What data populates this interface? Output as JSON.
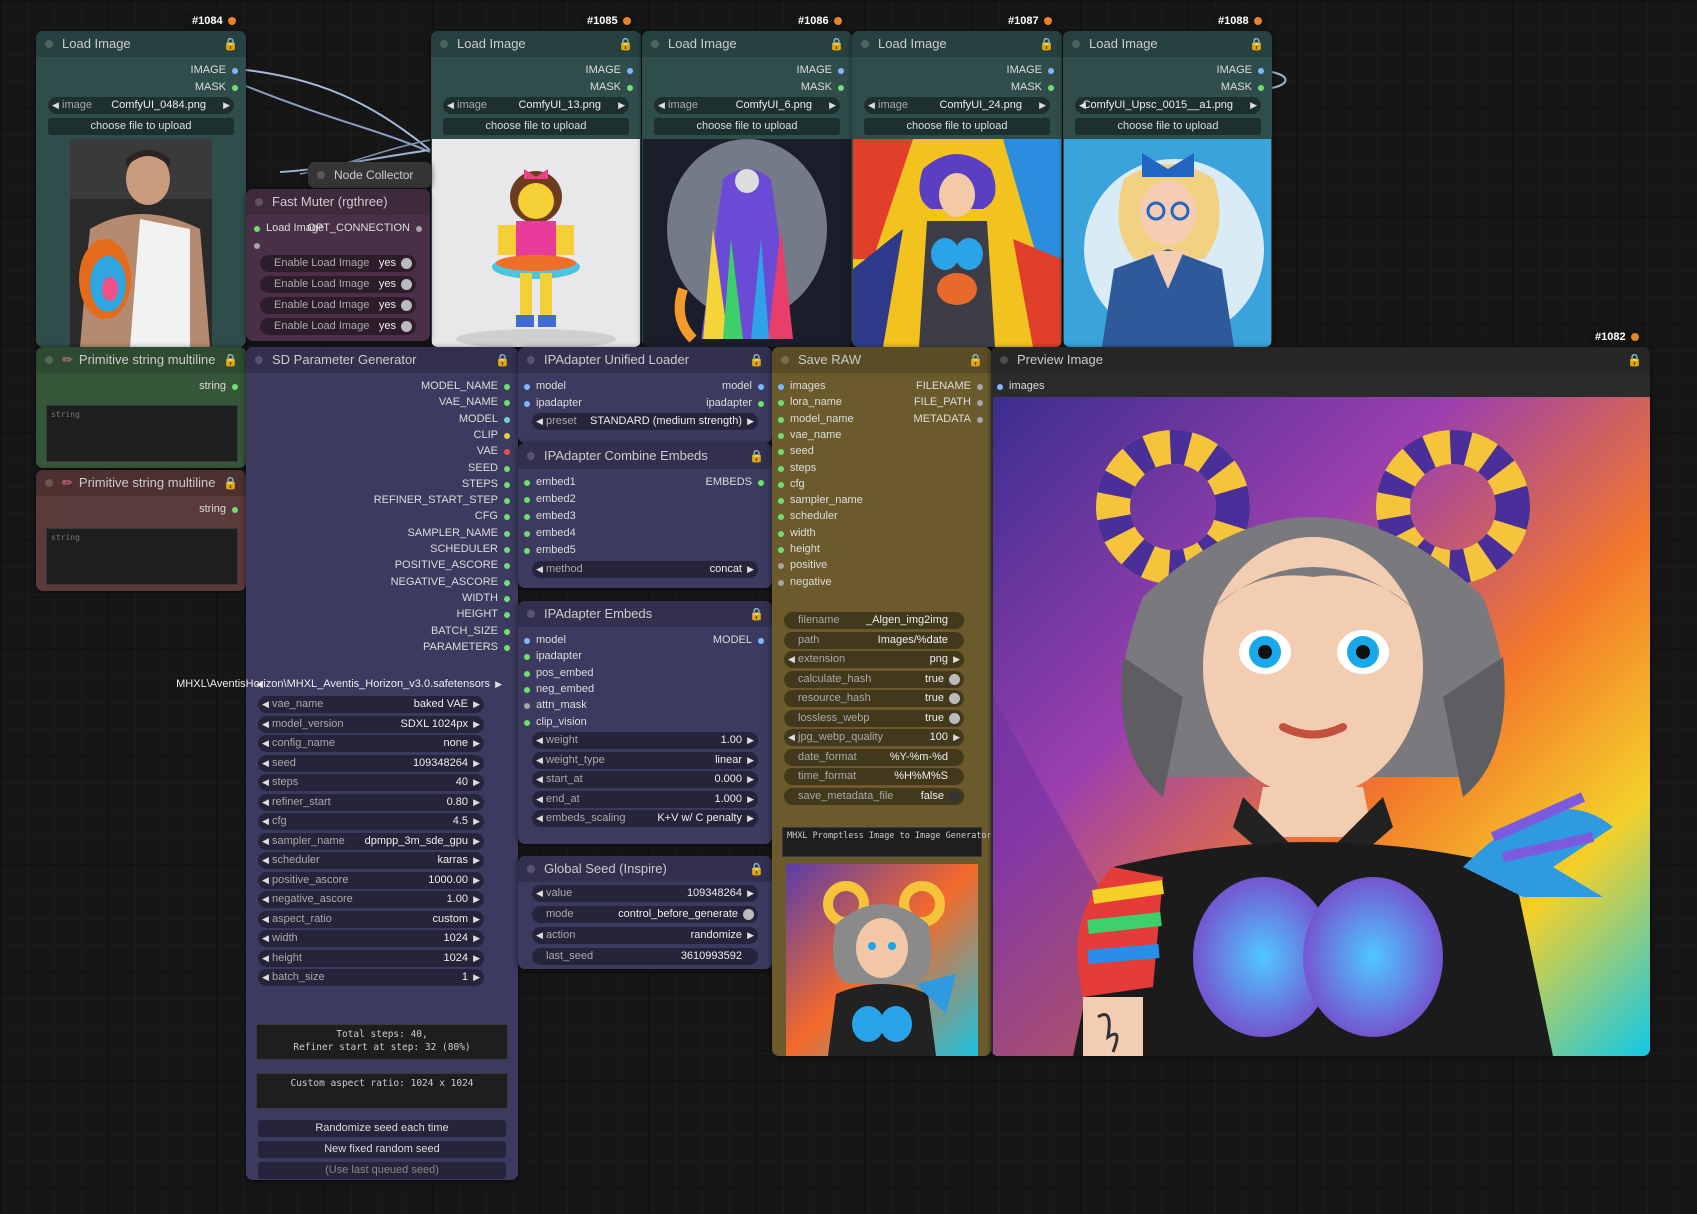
{
  "ids": {
    "n1084": "#1084",
    "n1085": "#1085",
    "n1086": "#1086",
    "n1087": "#1087",
    "n1088": "#1088",
    "n1082": "#1082"
  },
  "load_images": [
    {
      "title": "Load Image",
      "image_label": "image",
      "file": "ComfyUI_0484.png",
      "upload": "choose file to upload",
      "out_image": "IMAGE",
      "out_mask": "MASK"
    },
    {
      "title": "Load Image",
      "image_label": "image",
      "file": "ComfyUI_13.png",
      "upload": "choose file to upload",
      "out_image": "IMAGE",
      "out_mask": "MASK"
    },
    {
      "title": "Load Image",
      "image_label": "image",
      "file": "ComfyUI_6.png",
      "upload": "choose file to upload",
      "out_image": "IMAGE",
      "out_mask": "MASK"
    },
    {
      "title": "Load Image",
      "image_label": "image",
      "file": "ComfyUI_24.png",
      "upload": "choose file to upload",
      "out_image": "IMAGE",
      "out_mask": "MASK"
    },
    {
      "title": "Load Image",
      "image_label": "image",
      "file": "ComfyUI_Upsc_0015__a1.png",
      "upload": "choose file to upload",
      "out_image": "IMAGE",
      "out_mask": "MASK"
    }
  ],
  "node_collector": {
    "title": "Node Collector (rgth"
  },
  "fast_muter": {
    "title": "Fast Muter (rgthree)",
    "input": "Load Image",
    "output": "OPT_CONNECTION",
    "toggles": [
      {
        "label": "Enable Load Image",
        "value": "yes"
      },
      {
        "label": "Enable Load Image",
        "value": "yes"
      },
      {
        "label": "Enable Load Image",
        "value": "yes"
      },
      {
        "label": "Enable Load Image",
        "value": "yes"
      }
    ]
  },
  "prim1": {
    "title": "Primitive string multiline",
    "out": "string",
    "placeholder": "string"
  },
  "prim2": {
    "title": "Primitive string multiline",
    "out": "string",
    "placeholder": "string"
  },
  "sdparam": {
    "title": "SD Parameter Generator",
    "outputs": [
      "MODEL_NAME",
      "VAE_NAME",
      "MODEL",
      "CLIP",
      "VAE",
      "SEED",
      "STEPS",
      "REFINER_START_STEP",
      "CFG",
      "SAMPLER_NAME",
      "SCHEDULER",
      "POSITIVE_ASCORE",
      "NEGATIVE_ASCORE",
      "WIDTH",
      "HEIGHT",
      "BATCH_SIZE",
      "PARAMETERS"
    ],
    "ckpt": "MHXL\\AventisHorizon\\MHXL_Aventis_Horizon_v3.0.safetensors",
    "widgets": [
      {
        "label": "vae_name",
        "value": "baked VAE"
      },
      {
        "label": "model_version",
        "value": "SDXL 1024px"
      },
      {
        "label": "config_name",
        "value": "none"
      },
      {
        "label": "seed",
        "value": "109348264"
      },
      {
        "label": "steps",
        "value": "40"
      },
      {
        "label": "refiner_start",
        "value": "0.80"
      },
      {
        "label": "cfg",
        "value": "4.5"
      },
      {
        "label": "sampler_name",
        "value": "dpmpp_3m_sde_gpu"
      },
      {
        "label": "scheduler",
        "value": "karras"
      },
      {
        "label": "positive_ascore",
        "value": "1000.00"
      },
      {
        "label": "negative_ascore",
        "value": "1.00"
      },
      {
        "label": "aspect_ratio",
        "value": "custom"
      },
      {
        "label": "width",
        "value": "1024"
      },
      {
        "label": "height",
        "value": "1024"
      },
      {
        "label": "batch_size",
        "value": "1"
      }
    ],
    "info1": "Total steps: 40,\nRefiner start at step: 32 (80%)",
    "info2": "Custom aspect ratio: 1024 x 1024",
    "btn1": "Randomize seed each time",
    "btn2": "New fixed random seed",
    "btn3": "(Use last queued seed)"
  },
  "ipa_loader": {
    "title": "IPAdapter Unified Loader",
    "in_model": "model",
    "in_ipadapter": "ipadapter",
    "out_model": "model",
    "out_ipadapter": "ipadapter",
    "preset_label": "preset",
    "preset_value": "STANDARD (medium strength)"
  },
  "ipa_combine": {
    "title": "IPAdapter Combine Embeds",
    "inputs": [
      "embed1",
      "embed2",
      "embed3",
      "embed4",
      "embed5"
    ],
    "out": "EMBEDS",
    "method_label": "method",
    "method_value": "concat"
  },
  "ipa_embeds": {
    "title": "IPAdapter Embeds",
    "inputs": [
      "model",
      "ipadapter",
      "pos_embed",
      "neg_embed",
      "attn_mask",
      "clip_vision"
    ],
    "out": "MODEL",
    "widgets": [
      {
        "label": "weight",
        "value": "1.00"
      },
      {
        "label": "weight_type",
        "value": "linear"
      },
      {
        "label": "start_at",
        "value": "0.000"
      },
      {
        "label": "end_at",
        "value": "1.000"
      },
      {
        "label": "embeds_scaling",
        "value": "K+V w/ C penalty"
      }
    ]
  },
  "global_seed": {
    "title": "Global Seed (Inspire)",
    "widgets": [
      {
        "label": "value",
        "value": "109348264"
      },
      {
        "label": "mode",
        "value": "control_before_generate"
      },
      {
        "label": "action",
        "value": "randomize"
      },
      {
        "label": "last_seed",
        "value": "3610993592"
      }
    ]
  },
  "save_raw": {
    "title": "Save RAW",
    "inputs": [
      "images",
      "lora_name",
      "model_name",
      "vae_name",
      "seed",
      "steps",
      "cfg",
      "sampler_name",
      "scheduler",
      "width",
      "height",
      "positive",
      "negative"
    ],
    "outputs": [
      "FILENAME",
      "FILE_PATH",
      "METADATA"
    ],
    "widgets": [
      {
        "label": "filename",
        "value": "_Algen_img2img"
      },
      {
        "label": "path",
        "value": "Images/%date"
      },
      {
        "label": "extension",
        "value": "png"
      },
      {
        "label": "calculate_hash",
        "value": "true"
      },
      {
        "label": "resource_hash",
        "value": "true"
      },
      {
        "label": "lossless_webp",
        "value": "true"
      },
      {
        "label": "jpg_webp_quality",
        "value": "100"
      },
      {
        "label": "date_format",
        "value": "%Y-%m-%d"
      },
      {
        "label": "time_format",
        "value": "%H%M%S"
      },
      {
        "label": "save_metadata_file",
        "value": "false"
      }
    ],
    "note": "MHXL Promptless Image to Image Generator"
  },
  "preview": {
    "title": "Preview Image",
    "in": "images"
  },
  "colors": {
    "teal": "#2f4d4b",
    "teal_hdr": "#274140",
    "purple": "#3c3a5e",
    "purple_hdr": "#332f4f",
    "olive": "#6b5b2c",
    "olive_hdr": "#5a4c25",
    "green": "#36563a",
    "brown": "#5a3a3a",
    "muter": "#4a3046",
    "preview": "#2b2b2b",
    "accent_lock": "#e4a637"
  }
}
